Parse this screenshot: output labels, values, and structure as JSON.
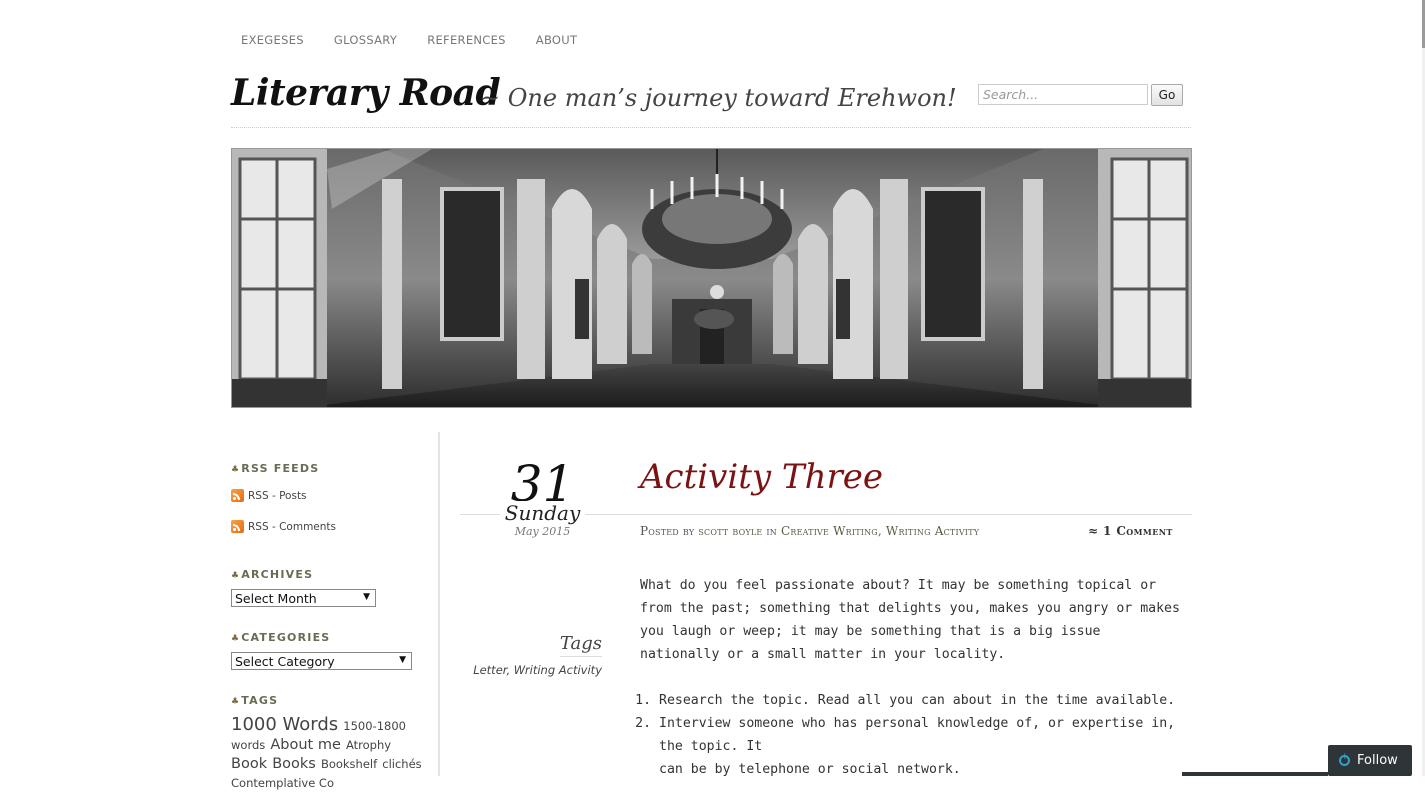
{
  "nav": {
    "items": [
      "EXEGESES",
      "GLOSSARY",
      "REFERENCES",
      "ABOUT"
    ]
  },
  "header": {
    "title": "Literary Road",
    "tagline": "~ One man’s journey toward Erehwon!",
    "search_placeholder": "Search...",
    "go_label": "Go"
  },
  "sidebar": {
    "rss_title": "RSS FEEDS",
    "rss_posts": "RSS - Posts",
    "rss_comments": "RSS - Comments",
    "archives_title": "ARCHIVES",
    "archives_selected": "Select Month",
    "categories_title": "CATEGORIES",
    "categories_selected": "Select Category",
    "tags_title": "TAGS",
    "tags": [
      {
        "label": "1000 Words",
        "size": 18
      },
      {
        "label": "1500-1800 words",
        "size": 11.5
      },
      {
        "label": "About me",
        "size": 14.5
      },
      {
        "label": "Atrophy",
        "size": 11.5
      },
      {
        "label": "Book",
        "size": 14.5
      },
      {
        "label": "Books",
        "size": 14.5
      },
      {
        "label": "Bookshelf",
        "size": 11.5
      },
      {
        "label": "clichés",
        "size": 11.5
      },
      {
        "label": "Contemplative Co",
        "size": 11.5
      }
    ]
  },
  "post": {
    "date_day_num": "31",
    "date_weekday": "Sunday",
    "date_month_year": "May 2015",
    "title": "Activity Three",
    "meta_posted_by": "Posted by",
    "meta_author": "scott boyle",
    "meta_in": "in",
    "meta_category1": "Creative Writing",
    "meta_sep": ",",
    "meta_category2": "Writing Activity",
    "comments": "≈ 1 Comment",
    "tags_label": "Tags",
    "tag1": "Letter",
    "tag2": "Writing Activity",
    "paragraph1": "What do you feel passionate about? It may be something topical or from the past; something that delights you, makes you angry or makes you laugh or weep; it may be something that is a big issue nationally or a small matter in your locality.",
    "list_item1": "Research the topic. Read all you can about in the time available.",
    "list_item2_line1": "Interview someone who has personal knowledge of, or expertise in, the topic. It",
    "list_item2_line2": "can be by telephone or social network."
  },
  "follow": {
    "label": "Follow"
  }
}
